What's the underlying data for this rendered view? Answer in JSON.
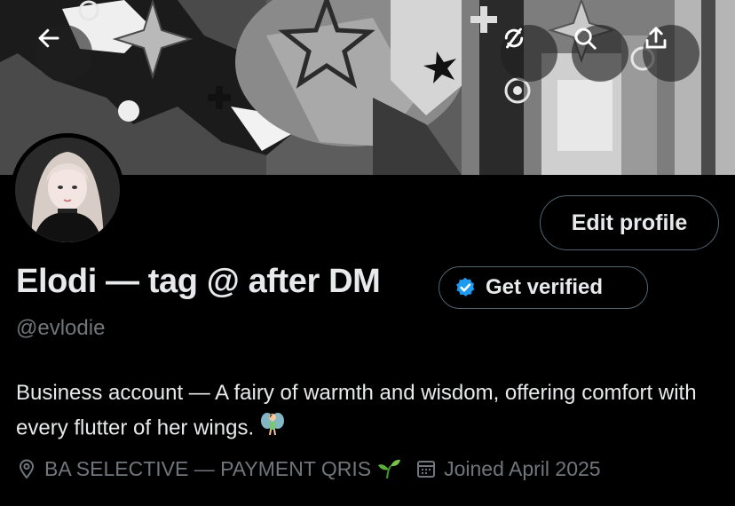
{
  "profile": {
    "display_name": "Elodi — tag @ after DM",
    "handle": "@evlodie",
    "bio": "Business account — A fairy of warmth and wisdom, offering comfort with every flutter of her wings.",
    "bio_emoji": "fairy",
    "location": "BA SELECTIVE — PAYMENT QRIS",
    "location_emoji": "seedling",
    "joined": "Joined April 2025"
  },
  "actions": {
    "edit_profile": "Edit profile",
    "get_verified": "Get verified"
  },
  "header_buttons": [
    "back-arrow-icon",
    "refresh-icon",
    "search-icon",
    "share-icon"
  ],
  "colors": {
    "background": "#000000",
    "primary_text": "#e7e9ea",
    "secondary_text": "#71767b",
    "border": "#536471",
    "verified_badge": "#1d9bf0"
  }
}
